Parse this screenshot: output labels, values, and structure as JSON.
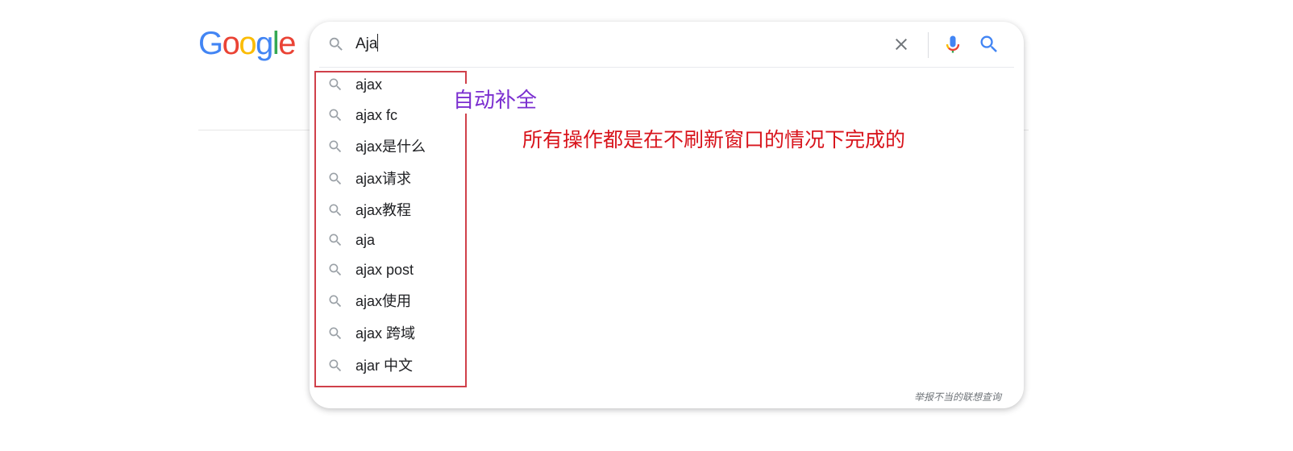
{
  "logo": {
    "letters": [
      {
        "ch": "G",
        "color": "#4285F4"
      },
      {
        "ch": "o",
        "color": "#EA4335"
      },
      {
        "ch": "o",
        "color": "#FBBC05"
      },
      {
        "ch": "g",
        "color": "#4285F4"
      },
      {
        "ch": "l",
        "color": "#34A853"
      },
      {
        "ch": "e",
        "color": "#EA4335"
      }
    ]
  },
  "search": {
    "query": "Aja",
    "icons": {
      "left": "search-icon",
      "clear": "close-icon",
      "voice": "mic-icon",
      "submit": "search-icon"
    }
  },
  "suggestions": [
    "ajax",
    "ajax fc",
    "ajax是什么",
    "ajax请求",
    "ajax教程",
    "aja",
    "ajax post",
    "ajax使用",
    "ajax 跨域",
    "ajar 中文"
  ],
  "report_link": "举报不当的联想查询",
  "annotations": {
    "autocomplete": "自动补全",
    "no_refresh": "所有操作都是在不刷新窗口的情况下完成的",
    "highlight_color": "#d0404a"
  },
  "colors": {
    "mic_blue": "#4285F4",
    "mic_red": "#EA4335",
    "mic_yellow": "#FBBC05",
    "mic_green": "#34A853",
    "search_blue": "#4285F4"
  }
}
